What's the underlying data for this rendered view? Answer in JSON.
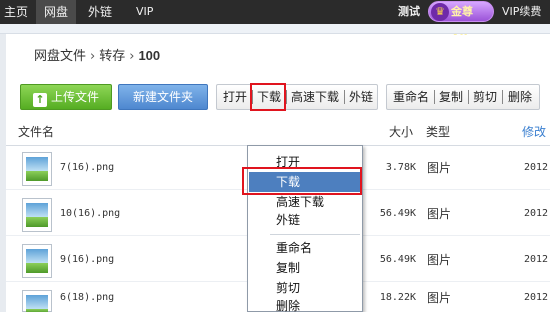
{
  "topbar": {
    "nav": [
      "主页",
      "网盘",
      "外链",
      "VIP"
    ],
    "user": "测试",
    "vip_badge": "金尊VIP",
    "renew": "VIP续费"
  },
  "breadcrumb": {
    "root": "网盘文件",
    "separator": "›",
    "items": [
      "转存",
      "100"
    ]
  },
  "toolbar": {
    "upload": "上传文件",
    "new_folder": "新建文件夹",
    "open": "打开",
    "download": "下载",
    "fast_download": "高速下载",
    "external_link": "外链",
    "rename": "重命名",
    "copy": "复制",
    "cut": "剪切",
    "delete": "删除"
  },
  "table": {
    "headers": {
      "name": "文件名",
      "size": "大小",
      "type": "类型",
      "modified": "修改"
    },
    "rows": [
      {
        "name": "7(16).png",
        "size": "3.78K",
        "type": "图片",
        "date": "2012"
      },
      {
        "name": "10(16).png",
        "size": "56.49K",
        "type": "图片",
        "date": "2012"
      },
      {
        "name": "9(16).png",
        "size": "56.49K",
        "type": "图片",
        "date": "2012"
      },
      {
        "name": "6(18).png",
        "size": "18.22K",
        "type": "图片",
        "date": "2012"
      }
    ]
  },
  "context_menu": {
    "items": [
      "打开",
      "下载",
      "高速下载",
      "外链",
      "重命名",
      "复制",
      "剪切",
      "删除"
    ],
    "selected": "下载"
  },
  "colors": {
    "topbar_bg": "#2b2b2b",
    "upload_green": "#55ad22",
    "new_folder_blue": "#4e87cf",
    "menu_selected": "#4d7fbf",
    "highlight_red": "#e0141e"
  }
}
